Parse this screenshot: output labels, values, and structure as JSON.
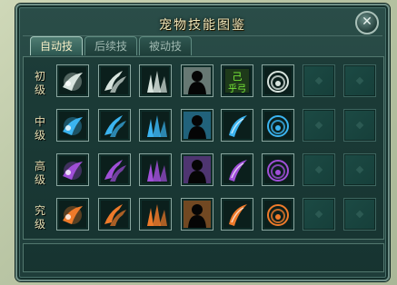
{
  "window": {
    "title": "宠物技能图鉴",
    "close_label": "✕"
  },
  "tabs": [
    {
      "label": "自动技",
      "active": true
    },
    {
      "label": "后续技",
      "active": false
    },
    {
      "label": "被动技",
      "active": false
    }
  ],
  "rows": [
    {
      "label": "初级",
      "icons": [
        "wind-fan-icon",
        "claw-gray-icon",
        "ice-shards-icon",
        "silhouette-red-icon",
        "green-rune-icon",
        "vortex-gray-icon"
      ]
    },
    {
      "label": "中级",
      "icons": [
        "blue-burst-icon",
        "claw-cyan-icon",
        "ice-shards-blue-icon",
        "silhouette-teal-icon",
        "blue-slash-icon",
        "vortex-cyan-icon"
      ]
    },
    {
      "label": "高级",
      "icons": [
        "purple-burst-icon",
        "claw-purple-icon",
        "shards-purple-icon",
        "silhouette-pink-icon",
        "purple-slash-icon",
        "vortex-purple-icon"
      ]
    },
    {
      "label": "究级",
      "icons": [
        "flower-burst-icon",
        "claw-orange-icon",
        "shards-orange-icon",
        "silhouette-orange-icon",
        "fire-slash-icon",
        "vortex-red-icon"
      ]
    }
  ],
  "colors": {
    "row1": "#d8e4de",
    "row2": "#3bb4f0",
    "row3": "#a04fd8",
    "row4": "#ee7a2a"
  }
}
